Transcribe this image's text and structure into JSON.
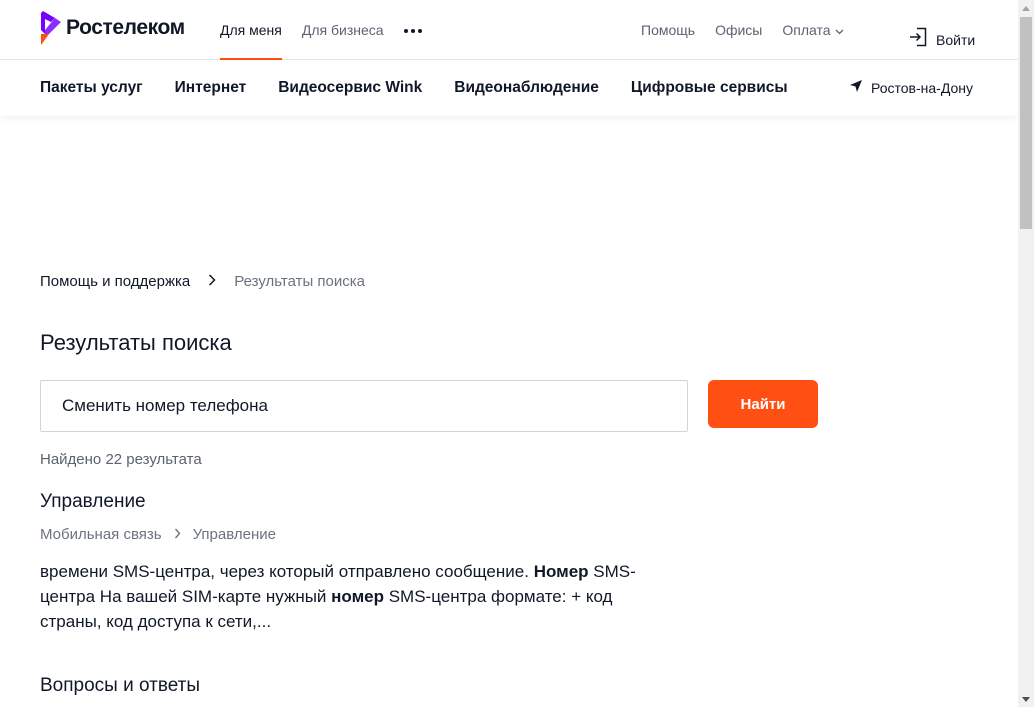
{
  "header": {
    "logo_text": "Ростелеком",
    "tabs": [
      {
        "label": "Для меня",
        "active": true
      },
      {
        "label": "Для бизнеса",
        "active": false
      }
    ],
    "more_icon": "more-dots-icon",
    "links": {
      "help": "Помощь",
      "offices": "Офисы",
      "payment": "Оплата"
    },
    "login_label": "Войти",
    "login_icon": "login-icon"
  },
  "nav": {
    "items": [
      "Пакеты услуг",
      "Интернет",
      "Видеосервис Wink",
      "Видеонаблюдение",
      "Цифровые сервисы"
    ],
    "city": "Ростов-на-Дону",
    "city_icon": "location-arrow-icon"
  },
  "breadcrumb": {
    "parent": "Помощь и поддержка",
    "current": "Результаты поиска"
  },
  "page_title": "Результаты поиска",
  "search": {
    "value": "Сменить номер телефона",
    "button_label": "Найти"
  },
  "found_count": "Найдено 22 результата",
  "results": [
    {
      "title": "Управление",
      "path": [
        "Мобильная связь",
        "Управление"
      ],
      "snippet": [
        {
          "text": "времени SMS-центра, через который отправлено сообщение. ",
          "bold": false
        },
        {
          "text": "Номер",
          "bold": true
        },
        {
          "text": " SMS-центра На вашей SIM-карте нужный ",
          "bold": false
        },
        {
          "text": "номер",
          "bold": true
        },
        {
          "text": " SMS-центра формате: + код страны, код доступа к сети,...",
          "bold": false
        }
      ]
    }
  ],
  "section_title": "Вопросы и ответы",
  "colors": {
    "accent": "#ff4f12",
    "logo_purple": "#7700ff",
    "text_primary": "#101828",
    "text_secondary": "#6b7280"
  }
}
